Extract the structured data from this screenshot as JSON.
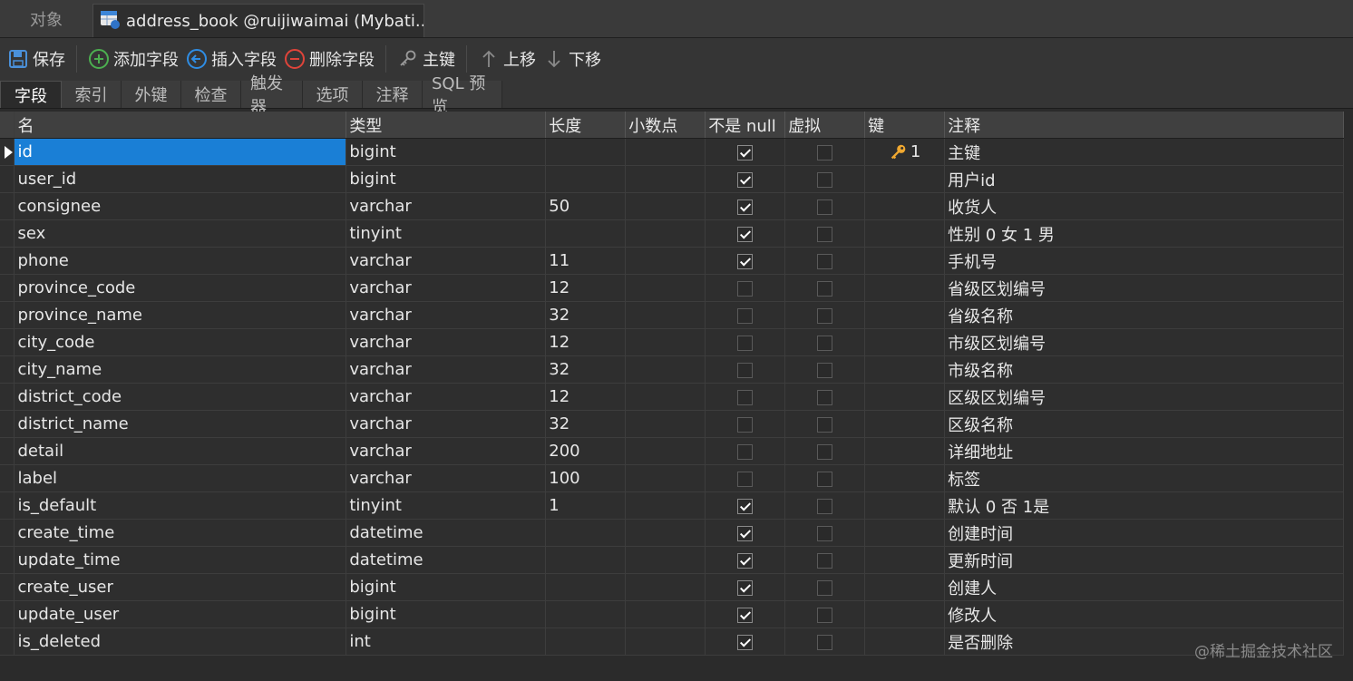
{
  "tabs": {
    "objects_label": "对象",
    "active_label": "address_book @ruijiwaimai (Mybati..."
  },
  "toolbar": {
    "save": "保存",
    "add_field": "添加字段",
    "insert_field": "插入字段",
    "delete_field": "删除字段",
    "primary_key": "主键",
    "move_up": "上移",
    "move_down": "下移"
  },
  "subtabs": [
    "字段",
    "索引",
    "外键",
    "检查",
    "触发器",
    "选项",
    "注释",
    "SQL 预览"
  ],
  "columns": {
    "name": "名",
    "type": "类型",
    "length": "长度",
    "decimals": "小数点",
    "not_null": "不是 null",
    "virtual": "虚拟",
    "key": "键",
    "comment": "注释"
  },
  "rows": [
    {
      "name": "id",
      "type": "bigint",
      "length": "",
      "decimals": "",
      "not_null": true,
      "virtual": false,
      "key": "1",
      "comment": "主键"
    },
    {
      "name": "user_id",
      "type": "bigint",
      "length": "",
      "decimals": "",
      "not_null": true,
      "virtual": false,
      "key": "",
      "comment": "用户id"
    },
    {
      "name": "consignee",
      "type": "varchar",
      "length": "50",
      "decimals": "",
      "not_null": true,
      "virtual": false,
      "key": "",
      "comment": "收货人"
    },
    {
      "name": "sex",
      "type": "tinyint",
      "length": "",
      "decimals": "",
      "not_null": true,
      "virtual": false,
      "key": "",
      "comment": "性别 0 女 1 男"
    },
    {
      "name": "phone",
      "type": "varchar",
      "length": "11",
      "decimals": "",
      "not_null": true,
      "virtual": false,
      "key": "",
      "comment": "手机号"
    },
    {
      "name": "province_code",
      "type": "varchar",
      "length": "12",
      "decimals": "",
      "not_null": false,
      "virtual": false,
      "key": "",
      "comment": "省级区划编号"
    },
    {
      "name": "province_name",
      "type": "varchar",
      "length": "32",
      "decimals": "",
      "not_null": false,
      "virtual": false,
      "key": "",
      "comment": "省级名称"
    },
    {
      "name": "city_code",
      "type": "varchar",
      "length": "12",
      "decimals": "",
      "not_null": false,
      "virtual": false,
      "key": "",
      "comment": "市级区划编号"
    },
    {
      "name": "city_name",
      "type": "varchar",
      "length": "32",
      "decimals": "",
      "not_null": false,
      "virtual": false,
      "key": "",
      "comment": "市级名称"
    },
    {
      "name": "district_code",
      "type": "varchar",
      "length": "12",
      "decimals": "",
      "not_null": false,
      "virtual": false,
      "key": "",
      "comment": "区级区划编号"
    },
    {
      "name": "district_name",
      "type": "varchar",
      "length": "32",
      "decimals": "",
      "not_null": false,
      "virtual": false,
      "key": "",
      "comment": "区级名称"
    },
    {
      "name": "detail",
      "type": "varchar",
      "length": "200",
      "decimals": "",
      "not_null": false,
      "virtual": false,
      "key": "",
      "comment": "详细地址"
    },
    {
      "name": "label",
      "type": "varchar",
      "length": "100",
      "decimals": "",
      "not_null": false,
      "virtual": false,
      "key": "",
      "comment": "标签"
    },
    {
      "name": "is_default",
      "type": "tinyint",
      "length": "1",
      "decimals": "",
      "not_null": true,
      "virtual": false,
      "key": "",
      "comment": "默认 0 否 1是"
    },
    {
      "name": "create_time",
      "type": "datetime",
      "length": "",
      "decimals": "",
      "not_null": true,
      "virtual": false,
      "key": "",
      "comment": "创建时间"
    },
    {
      "name": "update_time",
      "type": "datetime",
      "length": "",
      "decimals": "",
      "not_null": true,
      "virtual": false,
      "key": "",
      "comment": "更新时间"
    },
    {
      "name": "create_user",
      "type": "bigint",
      "length": "",
      "decimals": "",
      "not_null": true,
      "virtual": false,
      "key": "",
      "comment": "创建人"
    },
    {
      "name": "update_user",
      "type": "bigint",
      "length": "",
      "decimals": "",
      "not_null": true,
      "virtual": false,
      "key": "",
      "comment": "修改人"
    },
    {
      "name": "is_deleted",
      "type": "int",
      "length": "",
      "decimals": "",
      "not_null": true,
      "virtual": false,
      "key": "",
      "comment": "是否删除"
    }
  ],
  "selected_row": 0,
  "watermark": "@稀土掘金技术社区",
  "colors": {
    "selection": "#1a7fd6",
    "background": "#2b2b2b",
    "key_icon": "#f0a830"
  }
}
